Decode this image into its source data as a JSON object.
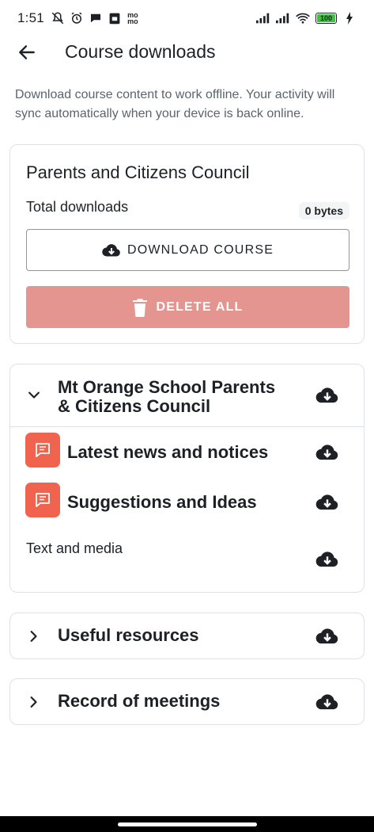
{
  "status_bar": {
    "time": "1:51",
    "left_icons": [
      "mute-icon",
      "alarm-icon",
      "chat-icon",
      "calendar-icon",
      "momo-icon"
    ],
    "momo_text": "mo mo",
    "right_icons": [
      "signal-icon",
      "signal-icon",
      "wifi-icon",
      "battery-icon",
      "charging-icon"
    ],
    "battery_level": "100"
  },
  "header": {
    "title": "Course downloads",
    "back_icon": "arrow-left-icon"
  },
  "intro_text": "Download course content to work offline. Your activity will sync automatically when your device is back online.",
  "summary": {
    "course_name": "Parents and Citizens Council",
    "total_label": "Total downloads",
    "total_value": "0 bytes",
    "download_button": "DOWNLOAD COURSE",
    "delete_button": "DELETE ALL"
  },
  "sections": [
    {
      "title": "Mt Orange School Parents & Citizens Council",
      "title_line1": "Mt Orange School Parents",
      "title_line2": "& Citizens Council",
      "expanded": true,
      "modules": [
        {
          "title": "Latest news and notices",
          "icon": "forum-icon"
        },
        {
          "title": "Suggestions and Ideas",
          "icon": "forum-icon"
        },
        {
          "title": "Text and media",
          "icon": ""
        }
      ]
    },
    {
      "title": "Useful resources",
      "expanded": false
    },
    {
      "title": "Record of meetings",
      "expanded": false
    }
  ],
  "colors": {
    "accent_module": "#f0644f",
    "delete_button_bg": "#e5958f",
    "battery_fill": "#3cc43c",
    "text_primary": "#1d2125",
    "text_secondary": "#5c636b"
  }
}
